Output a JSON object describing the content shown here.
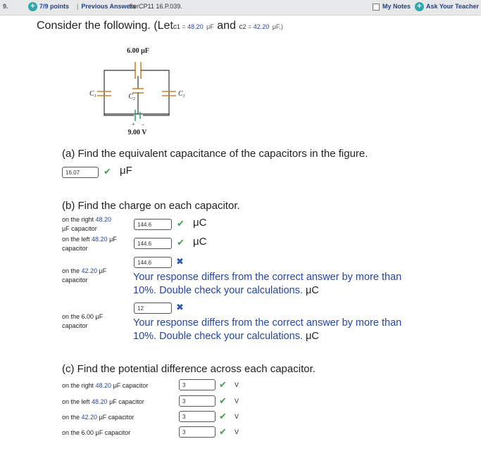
{
  "topbar": {
    "question_number": "9.",
    "points": "7/9 points",
    "separator": "|",
    "previous_answers": "Previous Answers",
    "problem_code": "SerCP11 16.P.039.",
    "my_notes": "My Notes",
    "ask_teacher": "Ask Your Teacher",
    "plus_glyph": "+"
  },
  "problem": {
    "prefix": "Consider the following. (Let",
    "c_symbol": "c",
    "c1_sub": "1",
    "c2_sub": "2",
    "equals": " = ",
    "c1_value": "48.20",
    "unit_muF": "μF",
    "and": " and ",
    "c2_value": "42.20",
    "suffix_unit": "μF.)"
  },
  "figure": {
    "top_cap_label": "6.00 μF",
    "left_cap_label": "C",
    "left_cap_sub": "1",
    "mid_cap_label": "C",
    "mid_cap_sub": "2",
    "right_cap_label": "C",
    "right_cap_sub": "1",
    "battery_label": "9.00 V",
    "battery_plus": "+",
    "battery_minus": "–"
  },
  "part_a": {
    "prompt": "(a) Find the equivalent capacitance of the capacitors in the figure.",
    "answer": "16.07",
    "unit": "μF",
    "status": "correct"
  },
  "part_b": {
    "prompt": "(b) Find the charge on each capacitor.",
    "rows": [
      {
        "label_pre": "on the right ",
        "label_val": "48.20",
        "label_line2": "μF capacitor",
        "answer": "144.6",
        "unit": "μC",
        "status": "correct"
      },
      {
        "label_pre": "on the left ",
        "label_val": "48.20",
        "label_unit": " μF",
        "label_line2": "capacitor",
        "answer": "144.6",
        "unit": "μC",
        "status": "correct"
      },
      {
        "label_pre": "on the ",
        "label_val": "42.20",
        "label_unit": " μF",
        "label_line2": "capacitor",
        "answer": "144.6",
        "status": "incorrect",
        "feedback_line1": "Your response differs from the correct answer by more than",
        "feedback_line2": "10%. Double check your calculations.",
        "feedback_unit": "μC"
      },
      {
        "label_pre": "on the 6.00 ",
        "label_unit": "μF",
        "label_line2": "capacitor",
        "answer": "12",
        "status": "incorrect",
        "feedback_line1": "Your response differs from the correct answer by more than",
        "feedback_line2": "10%. Double check your calculations.",
        "feedback_unit": "μC"
      }
    ]
  },
  "part_c": {
    "prompt": "(c) Find the potential difference across each capacitor.",
    "rows": [
      {
        "label_pre": "on the right ",
        "label_val": "48.20",
        "label_post": " μF capacitor",
        "answer": "3",
        "unit": "V",
        "status": "correct"
      },
      {
        "label_pre": "on the left ",
        "label_val": "48.20",
        "label_post": " μF capacitor",
        "answer": "3",
        "unit": "V",
        "status": "correct"
      },
      {
        "label_pre": "on the ",
        "label_val": "42.20",
        "label_post": " μF capacitor",
        "answer": "3",
        "unit": "V",
        "status": "correct"
      },
      {
        "label_pre": "on the 6.00 ",
        "label_post": "μF capacitor",
        "answer": "3",
        "unit": "V",
        "status": "correct"
      }
    ]
  },
  "icons": {
    "check_glyph": "✔",
    "cross_glyph": "✖"
  },
  "colors": {
    "accent_blue": "#2446a6",
    "correct_green": "#3fa34d",
    "incorrect_blue": "#2a5db0",
    "teal_plus": "#2ea8ad",
    "capacitor_orange": "#c9852a"
  }
}
